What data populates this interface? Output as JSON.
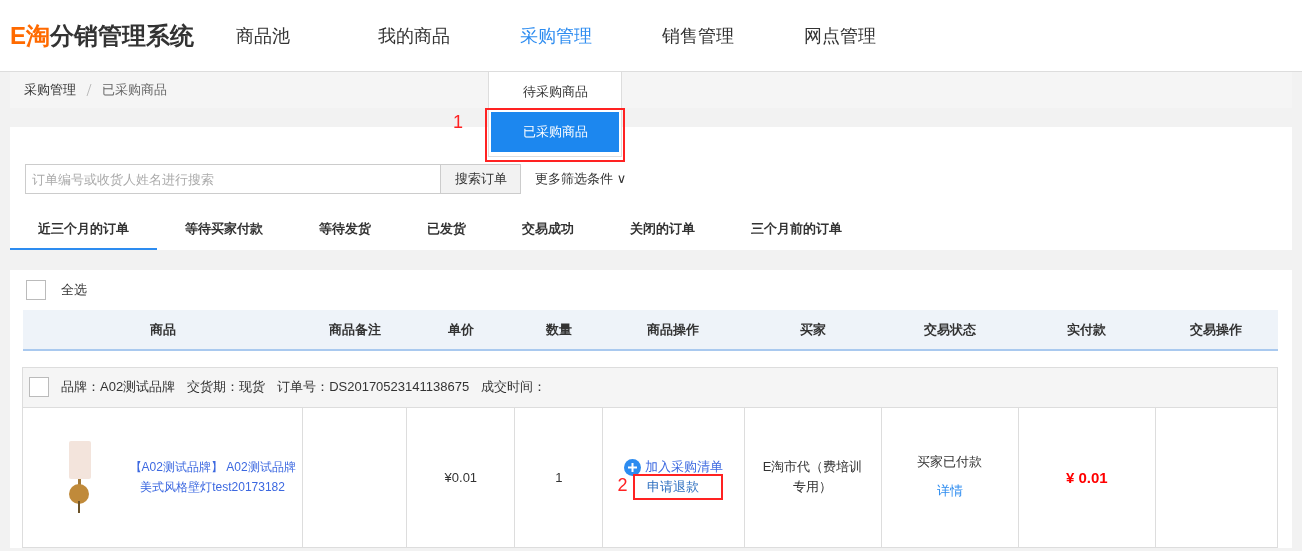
{
  "logo": {
    "accent": "E淘",
    "text": "分销管理系统"
  },
  "nav": [
    {
      "label": "商品池",
      "selected": false
    },
    {
      "label": "我的商品",
      "selected": false
    },
    {
      "label": "采购管理",
      "selected": true,
      "menu": [
        {
          "label": "待采购商品",
          "selected": false
        },
        {
          "label": "已采购商品",
          "selected": true
        }
      ]
    },
    {
      "label": "销售管理",
      "selected": false
    },
    {
      "label": "网点管理",
      "selected": false
    }
  ],
  "annotations": [
    {
      "number": "1"
    },
    {
      "number": "2"
    }
  ],
  "breadcrumb": [
    "采购管理",
    "已采购商品"
  ],
  "search": {
    "placeholder": "订单编号或收货人姓名进行搜索",
    "button": "搜索订单",
    "more_filters": "更多筛选条件",
    "more_caret": "∨"
  },
  "tabs": [
    {
      "label": "近三个月的订单",
      "selected": true
    },
    {
      "label": "等待买家付款",
      "selected": false
    },
    {
      "label": "等待发货",
      "selected": false
    },
    {
      "label": "已发货",
      "selected": false
    },
    {
      "label": "交易成功",
      "selected": false
    },
    {
      "label": "关闭的订单",
      "selected": false
    },
    {
      "label": "三个月前的订单",
      "selected": false
    }
  ],
  "select_all": {
    "label": "全选",
    "checked": false
  },
  "table": {
    "columns": [
      "商品",
      "商品备注",
      "单价",
      "数量",
      "商品操作",
      "买家",
      "交易状态",
      "实付款",
      "交易操作"
    ],
    "orders": [
      {
        "checked": false,
        "meta": [
          "品牌：A02测试品牌",
          "交货期：现货",
          "订单号：DS20170523141138675",
          "成交时间："
        ],
        "product": "【A02测试品牌】 A02测试品牌美式风格壁灯test20173182",
        "price": "¥0.01",
        "quantity": "1",
        "actions": [
          "加入采购清单",
          "申请退款"
        ],
        "buyer": "E淘市代（费培训专用）",
        "status": "买家已付款",
        "status_link": "详情",
        "paid": "¥ 0.01"
      }
    ]
  }
}
